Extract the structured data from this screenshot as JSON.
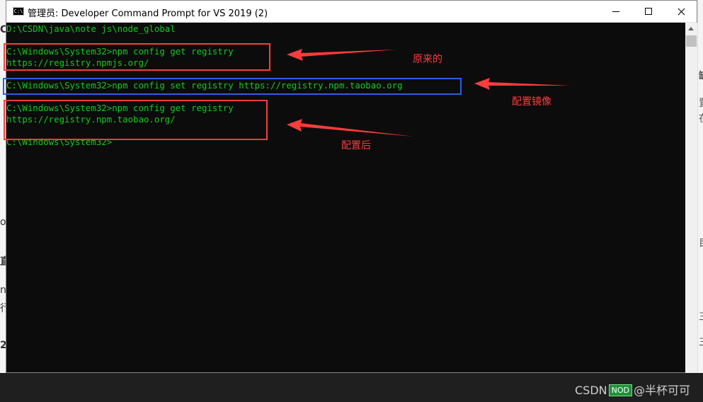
{
  "window": {
    "title": "管理员: Developer Command Prompt for VS 2019 (2)",
    "icon_label": "C:\\"
  },
  "console": {
    "lines": [
      "D:\\CSDN\\java\\note js\\node_global",
      "",
      "C:\\Windows\\System32>npm config get registry",
      "https://registry.npmjs.org/",
      "",
      "C:\\Windows\\System32>npm config set registry https://registry.npm.taobao.org",
      "",
      "C:\\Windows\\System32>npm config get registry",
      "https://registry.npm.taobao.org/",
      "",
      "C:\\Windows\\System32>"
    ]
  },
  "annotations": {
    "original": "原来的",
    "set_mirror": "配置镜像",
    "after": "配置后",
    "colors": {
      "red": "#ff3b3b",
      "blue": "#2f5fe0"
    }
  },
  "background": {
    "left_glyphs": [
      "C",
      "o",
      "直",
      "n",
      "行",
      "2"
    ],
    "right_glyphs": [
      "缺",
      "置",
      "在",
      "目",
      "三",
      "三"
    ],
    "watermark_prefix": "CSDN",
    "watermark_badge": "NOD",
    "watermark_suffix": "@半杯可可"
  },
  "colors": {
    "console_bg": "#0c0c0c",
    "console_text": "#13c81b",
    "titlebar_bg": "#ffffff"
  }
}
